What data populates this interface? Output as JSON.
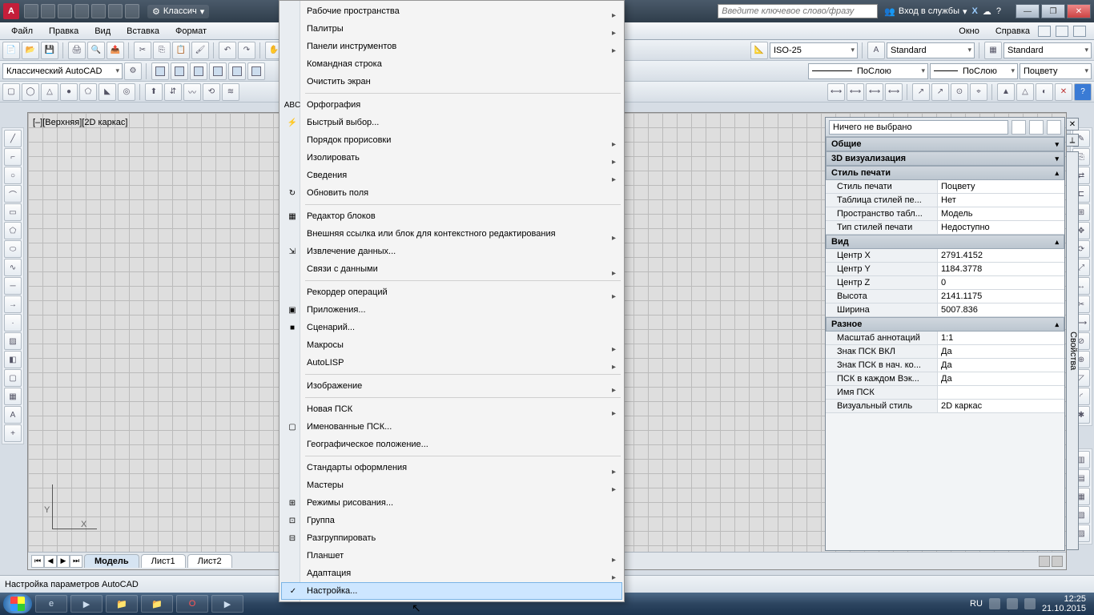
{
  "titlebar": {
    "logo": "A",
    "workspace_label": "Классич",
    "search_placeholder": "Введите ключевое слово/фразу",
    "signin": "Вход в службы",
    "minimize": "—",
    "maximize": "❐",
    "close": "✕"
  },
  "menubar": {
    "items": [
      "Файл",
      "Правка",
      "Вид",
      "Вставка",
      "Формат",
      "",
      "",
      "",
      "",
      "",
      "",
      "",
      "",
      "Окно",
      "Справка"
    ]
  },
  "toolrow2": {
    "workspace_combo": "Классический AutoCAD",
    "dimstyle": "ISO-25",
    "textstyle": "Standard",
    "tablestyle": "Standard"
  },
  "toolrow3": {
    "linetype": "ПоСлою",
    "lineweight": "ПоСлою",
    "color": "Поцвету"
  },
  "drawing": {
    "view_label": "[–][Верхняя][2D каркас]",
    "ucs_y": "Y",
    "ucs_x": "X"
  },
  "layouttabs": {
    "model": "Модель",
    "layout1": "Лист1",
    "layout2": "Лист2"
  },
  "props": {
    "selection": "Ничего не выбрано",
    "panel_title": "Свойства",
    "cats": {
      "general": "Общие",
      "viz3d": "3D визуализация",
      "plotstyle": "Стиль печати",
      "view": "Вид",
      "misc": "Разное"
    },
    "plot": {
      "style_k": "Стиль печати",
      "style_v": "Поцвету",
      "table_k": "Таблица стилей пе...",
      "table_v": "Нет",
      "space_k": "Пространство табл...",
      "space_v": "Модель",
      "type_k": "Тип стилей печати",
      "type_v": "Недоступно"
    },
    "view": {
      "cx_k": "Центр X",
      "cx_v": "2791.4152",
      "cy_k": "Центр Y",
      "cy_v": "1184.3778",
      "cz_k": "Центр Z",
      "cz_v": "0",
      "h_k": "Высота",
      "h_v": "2141.1175",
      "w_k": "Ширина",
      "w_v": "5007.836"
    },
    "misc": {
      "annoscale_k": "Масштаб аннотаций",
      "annoscale_v": "1:1",
      "ucsicon_k": "Знак ПСК ВКЛ",
      "ucsicon_v": "Да",
      "ucsorg_k": "Знак ПСК в нач. ко...",
      "ucsorg_v": "Да",
      "ucsvp_k": "ПСК в каждом Вэк...",
      "ucsvp_v": "Да",
      "ucsname_k": "Имя ПСК",
      "ucsname_v": "",
      "vstyle_k": "Визуальный стиль",
      "vstyle_v": "2D каркас"
    }
  },
  "menu": {
    "items": [
      {
        "label": "Рабочие пространства",
        "sub": true
      },
      {
        "label": "Палитры",
        "sub": true
      },
      {
        "label": "Панели инструментов",
        "sub": true
      },
      {
        "label": "Командная строка"
      },
      {
        "label": "Очистить экран"
      },
      {
        "sep": true
      },
      {
        "label": "Орфография",
        "icon": "ABC"
      },
      {
        "label": "Быстрый выбор...",
        "icon": "⚡"
      },
      {
        "label": "Порядок прорисовки",
        "sub": true
      },
      {
        "label": "Изолировать",
        "sub": true
      },
      {
        "label": "Сведения",
        "sub": true
      },
      {
        "label": "Обновить поля",
        "icon": "↻"
      },
      {
        "sep": true
      },
      {
        "label": "Редактор блоков",
        "icon": "▦"
      },
      {
        "label": "Внешняя ссылка или блок для контекстного редактирования",
        "sub": true
      },
      {
        "label": "Извлечение данных...",
        "icon": "⇲"
      },
      {
        "label": "Связи с данными",
        "sub": true
      },
      {
        "sep": true
      },
      {
        "label": "Рекордер операций",
        "sub": true
      },
      {
        "label": "Приложения...",
        "icon": "▣"
      },
      {
        "label": "Сценарий...",
        "icon": "■"
      },
      {
        "label": "Макросы",
        "sub": true
      },
      {
        "label": "AutoLISP",
        "sub": true
      },
      {
        "sep": true
      },
      {
        "label": "Изображение",
        "sub": true
      },
      {
        "sep": true
      },
      {
        "label": "Новая ПСК",
        "sub": true
      },
      {
        "label": "Именованные ПСК...",
        "icon": "▢"
      },
      {
        "label": "Географическое положение..."
      },
      {
        "sep": true
      },
      {
        "label": "Стандарты оформления",
        "sub": true
      },
      {
        "label": "Мастеры",
        "sub": true
      },
      {
        "label": "Режимы рисования...",
        "icon": "⊞"
      },
      {
        "label": "Группа",
        "icon": "⊡"
      },
      {
        "label": "Разгруппировать",
        "icon": "⊟"
      },
      {
        "label": "Планшет",
        "sub": true
      },
      {
        "label": "Адаптация",
        "sub": true
      },
      {
        "label": "Настройка...",
        "icon": "✓",
        "hl": true
      }
    ]
  },
  "status": {
    "text": "Настройка параметров AutoCAD"
  },
  "taskbar": {
    "lang": "RU",
    "time": "12:25",
    "date": "21.10.2015"
  }
}
